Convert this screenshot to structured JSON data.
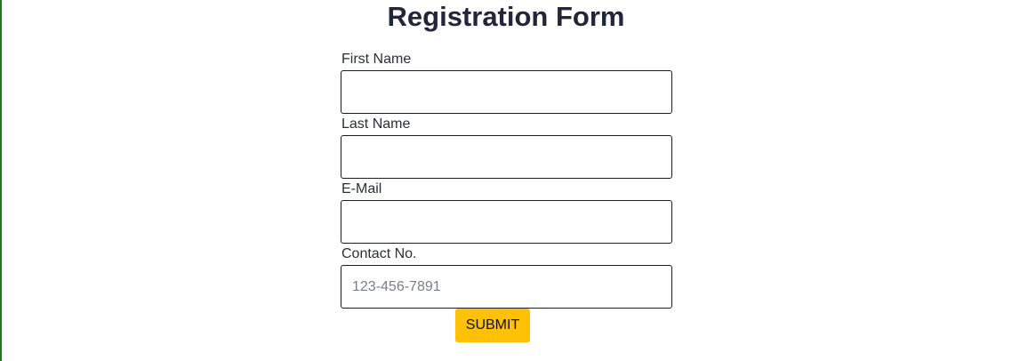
{
  "page": {
    "title": "Registration Form",
    "accent_color": "#ffc107",
    "border_color": "#1f7a1f"
  },
  "form": {
    "fields": [
      {
        "label": "First Name",
        "value": "",
        "placeholder": ""
      },
      {
        "label": "Last Name",
        "value": "",
        "placeholder": ""
      },
      {
        "label": "E-Mail",
        "value": "",
        "placeholder": ""
      },
      {
        "label": "Contact No.",
        "value": "",
        "placeholder": "123-456-7891"
      }
    ],
    "submit_label": "SUBMIT"
  }
}
